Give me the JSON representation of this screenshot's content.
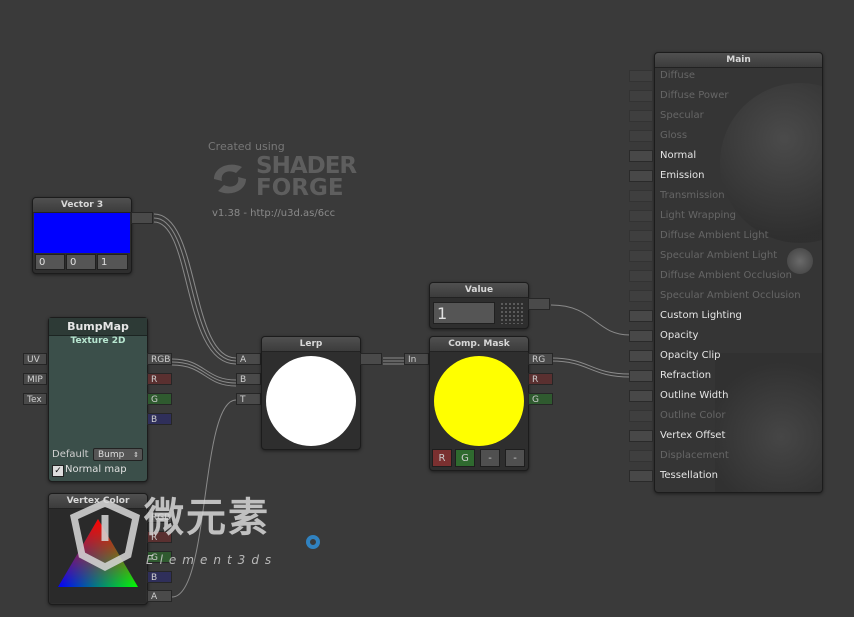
{
  "logo": {
    "created_using": "Created using",
    "line1": "SHADER",
    "line2": "FORGE",
    "version": "v1.38 - http://u3d.as/6cc"
  },
  "vector3": {
    "title": "Vector 3",
    "color": "#0000ff",
    "values": [
      "0",
      "0",
      "1"
    ]
  },
  "bumpmap": {
    "title": "BumpMap",
    "subtitle": "Texture 2D",
    "inputs": [
      "UV",
      "MIP",
      "Tex"
    ],
    "outputs": [
      "RGB",
      "R",
      "G",
      "B"
    ],
    "default_label": "Default",
    "default_value": "Bump",
    "normal_map_label": "Normal map",
    "normal_map_checked": true
  },
  "vertex_color": {
    "title": "Vertex Color",
    "outputs": [
      "RGB",
      "R",
      "G",
      "B",
      "A"
    ]
  },
  "lerp": {
    "title": "Lerp",
    "inputs": [
      "A",
      "B",
      "T"
    ],
    "preview_color": "#ffffff"
  },
  "value": {
    "title": "Value",
    "value": "1"
  },
  "comp_mask": {
    "title": "Comp. Mask",
    "input": "In",
    "outputs": [
      "RG",
      "R",
      "G"
    ],
    "preview_color": "#ffff00",
    "channels": [
      "R",
      "G",
      "-",
      "-"
    ]
  },
  "main": {
    "title": "Main",
    "rows": [
      {
        "label": "Diffuse",
        "enabled": false
      },
      {
        "label": "Diffuse Power",
        "enabled": false
      },
      {
        "label": "Specular",
        "enabled": false
      },
      {
        "label": "Gloss",
        "enabled": false
      },
      {
        "label": "Normal",
        "enabled": true
      },
      {
        "label": "Emission",
        "enabled": true
      },
      {
        "label": "Transmission",
        "enabled": false
      },
      {
        "label": "Light Wrapping",
        "enabled": false
      },
      {
        "label": "Diffuse Ambient Light",
        "enabled": false
      },
      {
        "label": "Specular Ambient Light",
        "enabled": false
      },
      {
        "label": "Diffuse Ambient Occlusion",
        "enabled": false
      },
      {
        "label": "Specular Ambient Occlusion",
        "enabled": false
      },
      {
        "label": "Custom Lighting",
        "enabled": true
      },
      {
        "label": "Opacity",
        "enabled": true
      },
      {
        "label": "Opacity Clip",
        "enabled": true
      },
      {
        "label": "Refraction",
        "enabled": true
      },
      {
        "label": "Outline Width",
        "enabled": true
      },
      {
        "label": "Outline Color",
        "enabled": false
      },
      {
        "label": "Vertex Offset",
        "enabled": true
      },
      {
        "label": "Displacement",
        "enabled": false
      },
      {
        "label": "Tessellation",
        "enabled": true
      }
    ]
  },
  "watermark": {
    "text_cn": "微元素",
    "text_en": "Element3ds"
  }
}
